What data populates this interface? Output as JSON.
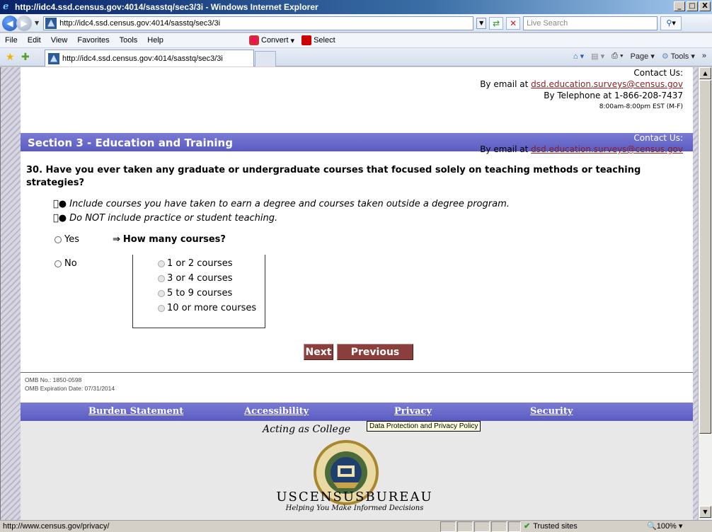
{
  "window": {
    "title": "http://idc4.ssd.census.gov:4014/sasstq/sec3/3i - Windows Internet Explorer",
    "buttons": [
      "_",
      "□",
      "X"
    ]
  },
  "address": {
    "url": "http://idc4.ssd.census.gov:4014/sasstq/sec3/3i",
    "search_placeholder": "Live Search"
  },
  "menu": {
    "items": [
      "File",
      "Edit",
      "View",
      "Favorites",
      "Tools",
      "Help"
    ],
    "convert": "Convert",
    "select": "Select"
  },
  "tab": {
    "label": "http://idc4.ssd.census.gov:4014/sasstq/sec3/3i",
    "page_label": "Page",
    "tools_label": "Tools"
  },
  "contact_top": {
    "heading": "Contact Us:",
    "email_prefix": "By email at ",
    "email": "dsd.education.surveys@census.gov",
    "phone": "By Telephone at 1-866-208-7437",
    "hours": "8:00am-8:00pm EST (M-F)"
  },
  "contact_bar": {
    "heading": "Contact Us:",
    "email_prefix": "By email at ",
    "email": "dsd.education.surveys@census.gov"
  },
  "section": {
    "title": "Section 3 - Education and Training"
  },
  "question": {
    "text": "30. Have you ever taken any graduate or undergraduate courses that focused solely on teaching methods or teaching strategies?",
    "instructions": [
      "Include courses you have taken to earn a degree and courses taken outside a degree program.",
      "Do NOT include practice or student teaching."
    ],
    "yes": "Yes",
    "no": "No",
    "followup_arrow": "⇒",
    "followup": "How many courses?",
    "course_options": [
      "1 or 2 courses",
      "3 or 4 courses",
      "5 to 9 courses",
      "10 or more courses"
    ]
  },
  "buttons": {
    "next": "Next",
    "previous": "Previous"
  },
  "omb": {
    "number": "OMB No.: 1850-0598",
    "expiration": "OMB Expiration Date: 07/31/2014"
  },
  "footer": {
    "links": [
      "Burden Statement",
      "Accessibility",
      "Privacy",
      "Security"
    ],
    "acting": "Acting as Colle",
    "acting_tail": "ge",
    "tooltip": "Data Protection and Privacy Policy",
    "brand": "USCENSUSBUREAU",
    "tagline": "Helping You Make Informed Decisions"
  },
  "status": {
    "url": "http://www.census.gov/privacy/",
    "zone": "Trusted sites",
    "zoom": "100%"
  },
  "colors": {
    "section_bar": "#5a5bc2",
    "button": "#8a3f3c",
    "link": "#8b1f1f"
  }
}
